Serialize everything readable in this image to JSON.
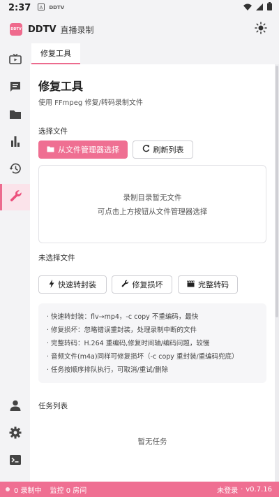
{
  "status_bar": {
    "time": "2:37",
    "icons": [
      "a-icon",
      "ddtv-notification-icon"
    ],
    "right_icons": [
      "wifi-icon",
      "signal-icon",
      "battery-icon"
    ]
  },
  "app": {
    "logo_text": "DDTV",
    "name": "DDTV",
    "subtitle": "直播录制"
  },
  "sidebar": {
    "items": [
      {
        "icon": "tv-icon",
        "active": false
      },
      {
        "icon": "chat-icon",
        "active": false
      },
      {
        "icon": "folder-icon",
        "active": false
      },
      {
        "icon": "bar-chart-icon",
        "active": false
      },
      {
        "icon": "history-icon",
        "active": false
      },
      {
        "icon": "wrench-icon",
        "active": true
      }
    ],
    "bottom_items": [
      {
        "icon": "person-icon"
      },
      {
        "icon": "gear-icon"
      },
      {
        "icon": "terminal-icon"
      }
    ]
  },
  "tabs": [
    {
      "label": "修复工具",
      "active": true
    }
  ],
  "page": {
    "title": "修复工具",
    "subtitle": "使用 FFmpeg 修复/转码录制文件",
    "select_file_label": "选择文件",
    "select_from_manager_label": "从文件管理器选择",
    "refresh_list_label": "刷新列表",
    "dropzone_line1": "录制目录暂无文件",
    "dropzone_line2": "可点击上方按钮从文件管理器选择",
    "no_file_selected": "未选择文件",
    "actions": {
      "quick_remux": "快速转封装",
      "repair": "修复损坏",
      "full_transcode": "完整转码"
    },
    "info_lines": [
      "· 快速转封装：flv→mp4，-c copy 不重编码，最快",
      "· 修复损坏：忽略错误重封装，处理录制中断的文件",
      "· 完整转码：H.264 重编码,修复时间轴/编码问题，较慢",
      "· 音频文件(m4a)同样可修复损坏（-c copy 重封装/重编码兜底）",
      "· 任务按顺序排队执行，可取消/重试/删除"
    ],
    "task_list_label": "任务列表",
    "no_tasks": "暂无任务"
  },
  "footer": {
    "recording": "0 录制中",
    "monitoring": "监控 0 房间",
    "login_status": "未登录",
    "version": "v0.7.16",
    "separator": "·"
  },
  "colors": {
    "accent": "#ef6f92",
    "active_bg": "#fbe3ea",
    "background": "#f3f3f5"
  }
}
